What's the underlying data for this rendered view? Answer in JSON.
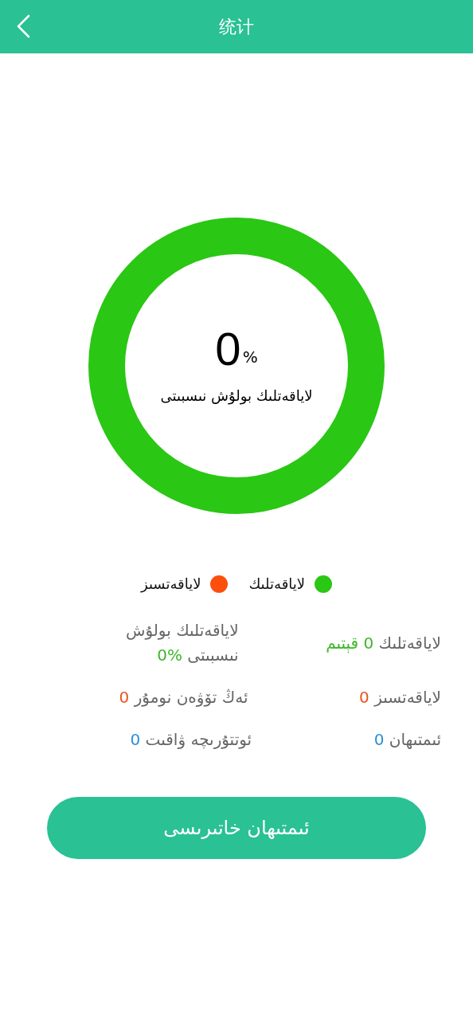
{
  "header": {
    "title": "统计"
  },
  "ring": {
    "value": "0",
    "unit": "%",
    "caption": "لاياقەتلىك بولۇش نىسبىتى"
  },
  "legend": [
    {
      "label": "لاياقەتلىك",
      "color": "#2ac714"
    },
    {
      "label": "لاياقەتسىز",
      "color": "#fc4f0e"
    }
  ],
  "stat_rows": [
    {
      "cells": [
        {
          "label": "لاياقەتلىك",
          "value": "0 قېتىم",
          "color": "#3db82a"
        },
        {
          "label": "لاياقەتلىك بولۇش نىسبىتى",
          "value": "%0",
          "color": "#3db82a"
        }
      ]
    },
    {
      "cells": [
        {
          "label": "لاياقەتسىز",
          "value": "0",
          "color": "#e8571e"
        },
        {
          "label": "ئەڭ تۆۋەن نومۇر",
          "value": "0",
          "color": "#e8571e"
        }
      ]
    },
    {
      "cells": [
        {
          "label": "ئىمتىھان",
          "value": "0",
          "color": "#2b90d9"
        },
        {
          "label": "ئوتتۇرىچە ۋاقىت",
          "value": "0",
          "color": "#2b90d9"
        }
      ]
    }
  ],
  "button": {
    "label": "ئىمتىھان خاتىرىسى"
  }
}
